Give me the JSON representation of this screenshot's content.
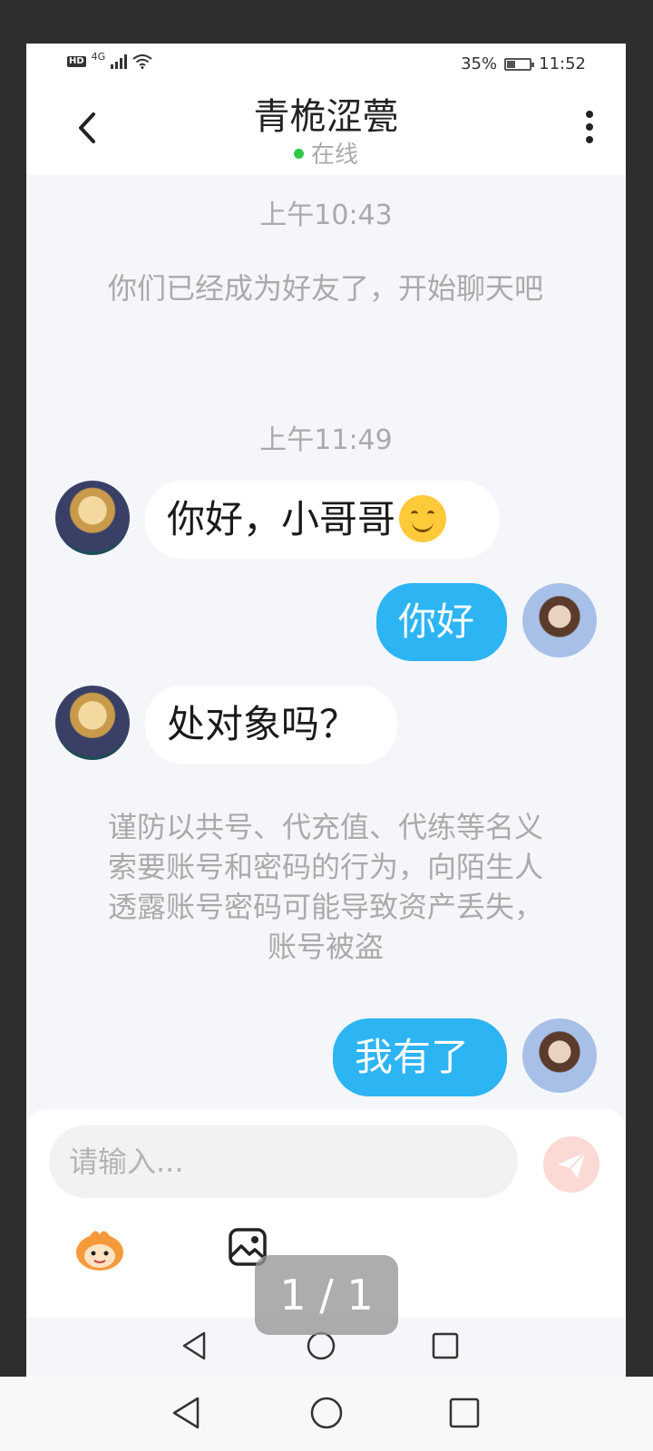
{
  "status_bar": {
    "network": "4G",
    "battery": "35%",
    "time": "11:52"
  },
  "header": {
    "title": "青桅涩甍",
    "presence": "在线"
  },
  "conversation": {
    "timestamp_1": "上午10:43",
    "system_notice_1": "你们已经成为好友了，开始聊天吧",
    "timestamp_2": "上午11:49",
    "messages": [
      {
        "from": "them",
        "text": "你好，小哥哥"
      },
      {
        "from": "me",
        "text": "你好"
      },
      {
        "from": "them",
        "text": "处对象吗？"
      },
      {
        "from": "me",
        "text": "我有了"
      }
    ],
    "warning": "谨防以共号、代充值、代练等名义索要账号和密码的行为，向陌生人透露账号密码可能导致资产丢失，账号被盗"
  },
  "composer": {
    "placeholder": "请输入..."
  },
  "viewer": {
    "pager": "1 / 1"
  },
  "icons": {
    "back": "back-chevron-icon",
    "more": "more-vertical-icon",
    "send": "send-icon",
    "emoji": "emoji-mascot-icon",
    "image": "image-icon",
    "emoji_inline": "smiling-face-icon"
  },
  "colors": {
    "accent": "#2db4f3",
    "online": "#2fc84b",
    "send_disabled": "#fbd9d5"
  }
}
